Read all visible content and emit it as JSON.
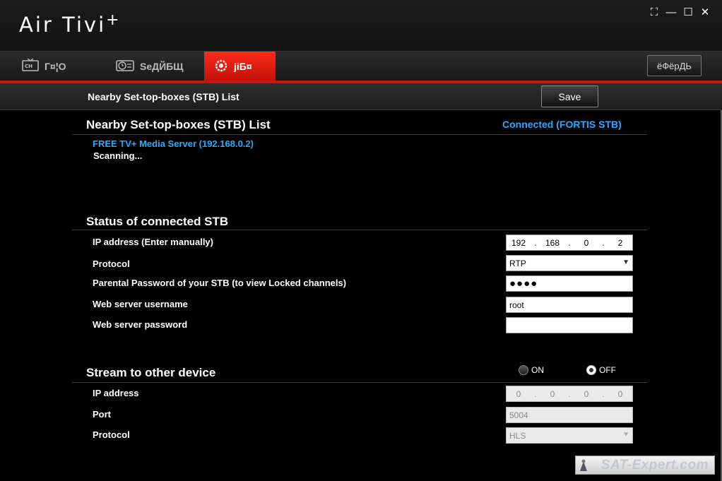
{
  "app": {
    "title": "Air Tivi",
    "title_sup": "+"
  },
  "window_controls": [
    "⛶",
    "—",
    "☐",
    "✕"
  ],
  "tabs": [
    {
      "label": "Г¤¦О",
      "icon": "tv-ch-icon",
      "active": false
    },
    {
      "label": "ЅеДЙБЩ",
      "icon": "schedule-icon",
      "active": false
    },
    {
      "label": "јіБ¤",
      "icon": "settings-icon",
      "active": true
    }
  ],
  "lang_button": "ёФёрДЬ",
  "header": {
    "title": "Nearby Set-top-boxes (STB) List",
    "save_label": "Save"
  },
  "nearby": {
    "title": "Nearby Set-top-boxes (STB) List",
    "connected_status": "Connected (FORTIS STB)",
    "server": "FREE TV+ Media Server (192.168.0.2)",
    "scanning": "Scanning..."
  },
  "status": {
    "title": "Status of connected STB",
    "ip_label": "IP address (Enter manually)",
    "ip": [
      "192",
      "168",
      "0",
      "2"
    ],
    "protocol_label": "Protocol",
    "protocol_value": "RTP",
    "parental_label": "Parental Password of your STB (to view Locked channels)",
    "parental_value": "●●●●",
    "username_label": "Web server username",
    "username_value": "root",
    "password_label": "Web server password",
    "password_value": ""
  },
  "stream": {
    "title": "Stream to other device",
    "on_label": "ON",
    "off_label": "OFF",
    "selected": "OFF",
    "ip_label": "IP address",
    "ip": [
      "0",
      "0",
      "0",
      "0"
    ],
    "port_label": "Port",
    "port_value": "5004",
    "protocol_label": "Protocol",
    "protocol_value": "HLS"
  },
  "watermark": "SAT-Expert.com",
  "colors": {
    "accent_red": "#c9160c",
    "link_blue": "#2fa8ff"
  }
}
